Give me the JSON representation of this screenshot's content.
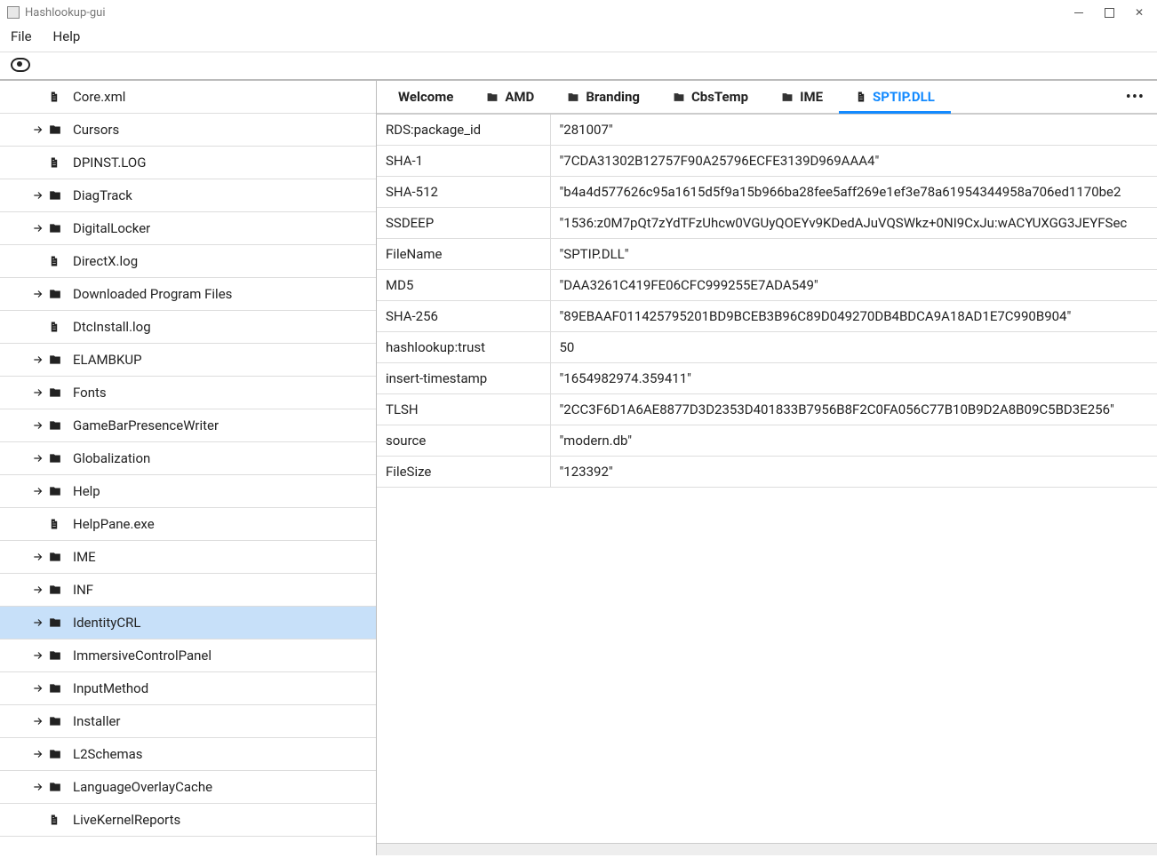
{
  "window": {
    "title": "Hashlookup-gui"
  },
  "menu": {
    "file": "File",
    "help": "Help"
  },
  "sidebar": {
    "items": [
      {
        "type": "file",
        "label": "Core.xml"
      },
      {
        "type": "folder",
        "label": "Cursors"
      },
      {
        "type": "file",
        "label": "DPINST.LOG"
      },
      {
        "type": "folder",
        "label": "DiagTrack"
      },
      {
        "type": "folder",
        "label": "DigitalLocker"
      },
      {
        "type": "file",
        "label": "DirectX.log"
      },
      {
        "type": "folder",
        "label": "Downloaded Program Files"
      },
      {
        "type": "file",
        "label": "DtcInstall.log"
      },
      {
        "type": "folder",
        "label": "ELAMBKUP"
      },
      {
        "type": "folder",
        "label": "Fonts"
      },
      {
        "type": "folder",
        "label": "GameBarPresenceWriter"
      },
      {
        "type": "folder",
        "label": "Globalization"
      },
      {
        "type": "folder",
        "label": "Help"
      },
      {
        "type": "file",
        "label": "HelpPane.exe"
      },
      {
        "type": "folder",
        "label": "IME"
      },
      {
        "type": "folder",
        "label": "INF"
      },
      {
        "type": "folder",
        "label": "IdentityCRL",
        "selected": true
      },
      {
        "type": "folder",
        "label": "ImmersiveControlPanel"
      },
      {
        "type": "folder",
        "label": "InputMethod"
      },
      {
        "type": "folder",
        "label": "Installer"
      },
      {
        "type": "folder",
        "label": "L2Schemas"
      },
      {
        "type": "folder",
        "label": "LanguageOverlayCache"
      },
      {
        "type": "file",
        "label": "LiveKernelReports"
      }
    ]
  },
  "tabs": [
    {
      "label": "Welcome",
      "type": "plain"
    },
    {
      "label": "AMD",
      "type": "folder"
    },
    {
      "label": "Branding",
      "type": "folder"
    },
    {
      "label": "CbsTemp",
      "type": "folder"
    },
    {
      "label": "IME",
      "type": "folder"
    },
    {
      "label": "SPTIP.DLL",
      "type": "file",
      "active": true
    }
  ],
  "details": [
    {
      "key": "RDS:package_id",
      "value": "\"281007\""
    },
    {
      "key": "SHA-1",
      "value": "\"7CDA31302B12757F90A25796ECFE3139D969AAA4\""
    },
    {
      "key": "SHA-512",
      "value": "\"b4a4d577626c95a1615d5f9a15b966ba28fee5aff269e1ef3e78a61954344958a706ed1170be2"
    },
    {
      "key": "SSDEEP",
      "value": "\"1536:z0M7pQt7zYdTFzUhcw0VGUyQOEYv9KDedAJuVQSWkz+0NI9CxJu:wACYUXGG3JEYFSec"
    },
    {
      "key": "FileName",
      "value": "\"SPTIP.DLL\""
    },
    {
      "key": "MD5",
      "value": "\"DAA3261C419FE06CFC999255E7ADA549\""
    },
    {
      "key": "SHA-256",
      "value": "\"89EBAAF011425795201BD9BCEB3B96C89D049270DB4BDCA9A18AD1E7C990B904\""
    },
    {
      "key": "hashlookup:trust",
      "value": "50"
    },
    {
      "key": "insert-timestamp",
      "value": "\"1654982974.359411\""
    },
    {
      "key": "TLSH",
      "value": "\"2CC3F6D1A6AE8877D3D2353D401833B7956B8F2C0FA056C77B10B9D2A8B09C5BD3E256\""
    },
    {
      "key": "source",
      "value": "\"modern.db\""
    },
    {
      "key": "FileSize",
      "value": "\"123392\""
    }
  ]
}
